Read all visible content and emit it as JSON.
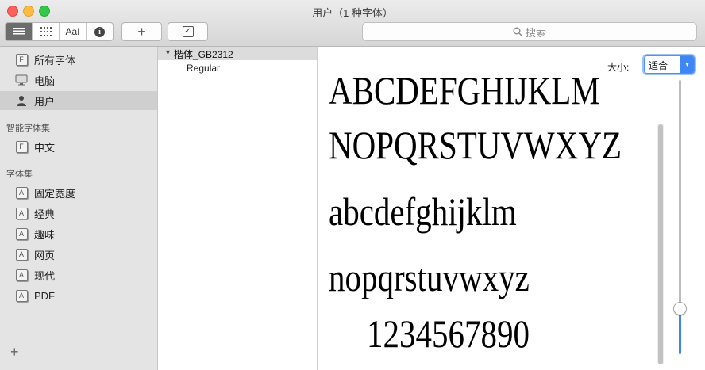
{
  "window": {
    "title": "用户（1 种字体）"
  },
  "toolbar": {
    "view_buttons": [
      {
        "name": "sample-view-icon"
      },
      {
        "name": "grid-view-icon"
      },
      {
        "name": "custom-text-view-icon",
        "label": "AaI"
      },
      {
        "name": "info-icon",
        "label": "i"
      }
    ],
    "add_label": "+",
    "check_label": "✓",
    "search_placeholder": "搜索"
  },
  "sidebar": {
    "items": [
      {
        "label": "所有字体",
        "icon": "font-library-icon",
        "selected": false
      },
      {
        "label": "电脑",
        "icon": "computer-icon",
        "selected": false
      },
      {
        "label": "用户",
        "icon": "user-icon",
        "selected": true
      }
    ],
    "smart_header": "智能字体集",
    "smart_items": [
      {
        "label": "中文",
        "icon": "font-library-icon"
      }
    ],
    "collections_header": "字体集",
    "collections": [
      {
        "label": "固定宽度",
        "icon": "collection-icon"
      },
      {
        "label": "经典",
        "icon": "collection-icon"
      },
      {
        "label": "趣味",
        "icon": "collection-icon"
      },
      {
        "label": "网页",
        "icon": "collection-icon"
      },
      {
        "label": "现代",
        "icon": "collection-icon"
      },
      {
        "label": "PDF",
        "icon": "collection-icon"
      }
    ],
    "add_label": "+"
  },
  "font_list": {
    "family": "楷体_GB2312",
    "styles": [
      "Regular"
    ]
  },
  "preview": {
    "size_label": "大小:",
    "size_value": "适合",
    "lines": [
      "ABCDEFGHIJKLM",
      "NOPQRSTUVWXYZ",
      "abcdefghijklm",
      "nopqrstuvwxyz",
      "1234567890"
    ],
    "size_slider_level": 0.16
  },
  "colors": {
    "accent": "#3f86f5",
    "selected_row": "#cfcfcf"
  }
}
